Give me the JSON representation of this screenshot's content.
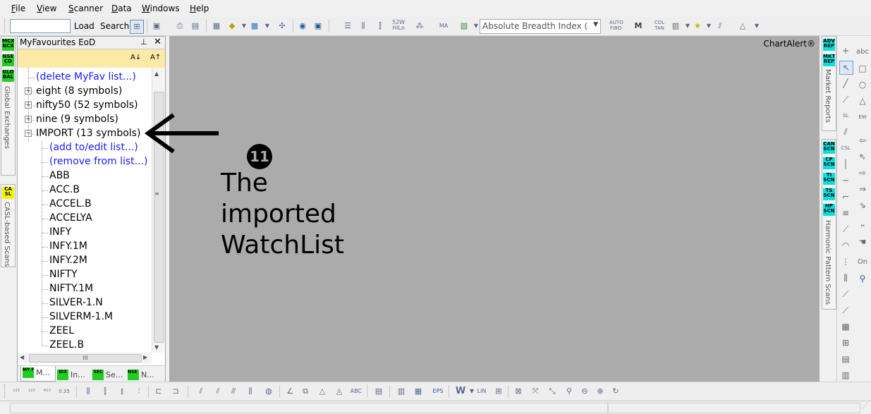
{
  "menu": [
    "File",
    "View",
    "Scanner",
    "Data",
    "Windows",
    "Help"
  ],
  "toolbar": {
    "symbol_input_value": "",
    "load_label": "Load",
    "search_label": "Search",
    "indicator_value": "Absolute Breadth Index (ABI"
  },
  "left_tabs": {
    "global_exchanges": "Global Exchanges",
    "casl_scans": "CASL-based Scans",
    "badges": [
      "MCX NCX",
      "NSE CD",
      "GLO BAL",
      "CA SL"
    ]
  },
  "panel": {
    "title": "MyFavourites EoD",
    "sort_asc": "A↓",
    "sort_desc": "A↑",
    "tree": [
      {
        "label": "(delete MyFav list...)",
        "type": "action",
        "level": 1
      },
      {
        "label": "eight (8 symbols)",
        "type": "group",
        "level": 1,
        "expanded": false
      },
      {
        "label": "nifty50 (52 symbols)",
        "type": "group",
        "level": 1,
        "expanded": false
      },
      {
        "label": "nine (9 symbols)",
        "type": "group",
        "level": 1,
        "expanded": false
      },
      {
        "label": "IMPORT (13 symbols)",
        "type": "group",
        "level": 1,
        "expanded": true
      },
      {
        "label": "(add to/edit list...)",
        "type": "action",
        "level": 2
      },
      {
        "label": "(remove from list...)",
        "type": "action",
        "level": 2
      },
      {
        "label": "ABB",
        "type": "symbol",
        "level": 2
      },
      {
        "label": "ACC.B",
        "type": "symbol",
        "level": 2
      },
      {
        "label": "ACCEL.B",
        "type": "symbol",
        "level": 2
      },
      {
        "label": "ACCELYA",
        "type": "symbol",
        "level": 2
      },
      {
        "label": "INFY",
        "type": "symbol",
        "level": 2
      },
      {
        "label": "INFY.1M",
        "type": "symbol",
        "level": 2
      },
      {
        "label": "INFY.2M",
        "type": "symbol",
        "level": 2
      },
      {
        "label": "NIFTY",
        "type": "symbol",
        "level": 2
      },
      {
        "label": "NIFTY.1M",
        "type": "symbol",
        "level": 2
      },
      {
        "label": "SILVER-1.N",
        "type": "symbol",
        "level": 2
      },
      {
        "label": "SILVERM-1.M",
        "type": "symbol",
        "level": 2
      },
      {
        "label": "ZEEL",
        "type": "symbol",
        "level": 2
      },
      {
        "label": "ZEEL.B",
        "type": "symbol",
        "level": 2
      }
    ],
    "hscroll_thumb": "III",
    "tabs": [
      {
        "badge": "MY FAV",
        "label": "M...",
        "badge_color": "#22cc22"
      },
      {
        "badge": "IDX",
        "label": "In...",
        "badge_color": "#22cc22"
      },
      {
        "badge": "SEC",
        "label": "Se...",
        "badge_color": "#22cc22"
      },
      {
        "badge": "NSE F&O",
        "label": "N...",
        "badge_color": "#22cc22"
      }
    ]
  },
  "chart": {
    "brand": "ChartAlert®",
    "callout_number": "11",
    "callout_lines": [
      "The",
      "imported",
      "WatchList"
    ]
  },
  "right_tabs": {
    "market_reports": "Market Reports",
    "harmonic_scans": "Harmonic Pattern Scans",
    "badges": [
      "ADV REP",
      "MKT REP",
      "CAN SCN",
      "CP SCN",
      "TI SCN",
      "TS SCN",
      "HP SCN"
    ]
  },
  "draw_tools": {
    "abc": "abc",
    "on": "On"
  },
  "colors": {
    "chart_bg": "#ababab",
    "sortbar_bg": "#fde9a6",
    "link": "#1a1aff",
    "badge_green": "#22cc22",
    "badge_cyan": "#00e0e0",
    "badge_yellow": "#f4f400"
  }
}
